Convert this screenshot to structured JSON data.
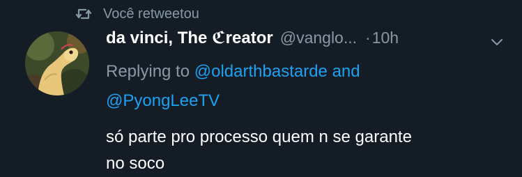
{
  "retweet": {
    "icon": "retweet-icon",
    "label": "Você retweetou"
  },
  "tweet": {
    "author": {
      "display_name": "da vinci, The ℭreator",
      "handle": "@vanglo...",
      "avatar": "avatar"
    },
    "dot": "·",
    "time": "10h",
    "menu_icon": "chevron-down-icon",
    "reply": {
      "prefix": "Replying to ",
      "mention1": "@oldarthbastarde",
      "conjunction": " and",
      "mention2": "@PyongLeeTV"
    },
    "text_line1": "só parte pro processo quem n se garante",
    "text_line2": "no soco"
  },
  "colors": {
    "background": "#141d26",
    "primary_text": "#ffffff",
    "secondary_text": "#8899a6",
    "link": "#1da1f2"
  }
}
